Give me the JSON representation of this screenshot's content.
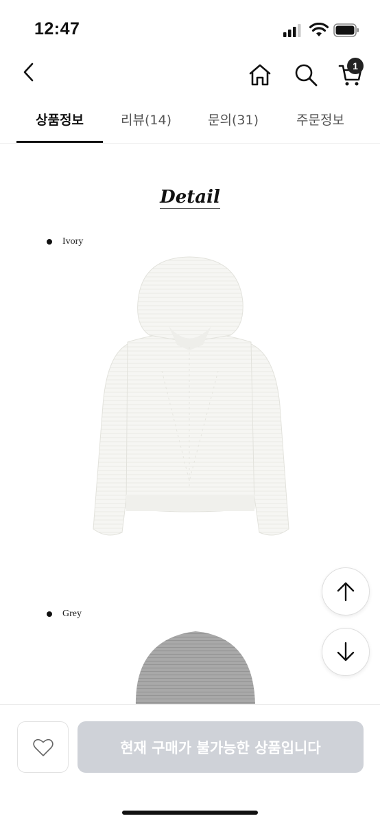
{
  "status_bar": {
    "time": "12:47"
  },
  "nav": {
    "back_icon": "chevron-left-icon",
    "home_icon": "home-icon",
    "search_icon": "search-icon",
    "cart_icon": "cart-icon",
    "cart_badge": "1"
  },
  "tabs": [
    {
      "label": "상품정보",
      "active": true
    },
    {
      "label": "리뷰(14)",
      "active": false
    },
    {
      "label": "문의(31)",
      "active": false
    },
    {
      "label": "주문정보",
      "active": false
    }
  ],
  "detail": {
    "title": "Detail",
    "colors": [
      "Ivory",
      "Grey"
    ]
  },
  "scroll_buttons": {
    "up_icon": "arrow-up-icon",
    "down_icon": "arrow-down-icon"
  },
  "bottom": {
    "wish_icon": "heart-icon",
    "buy_label": "현재 구매가 불가능한 상품입니다"
  },
  "colors": {
    "accent": "#111111",
    "disabled_button": "#cfd2d8"
  }
}
